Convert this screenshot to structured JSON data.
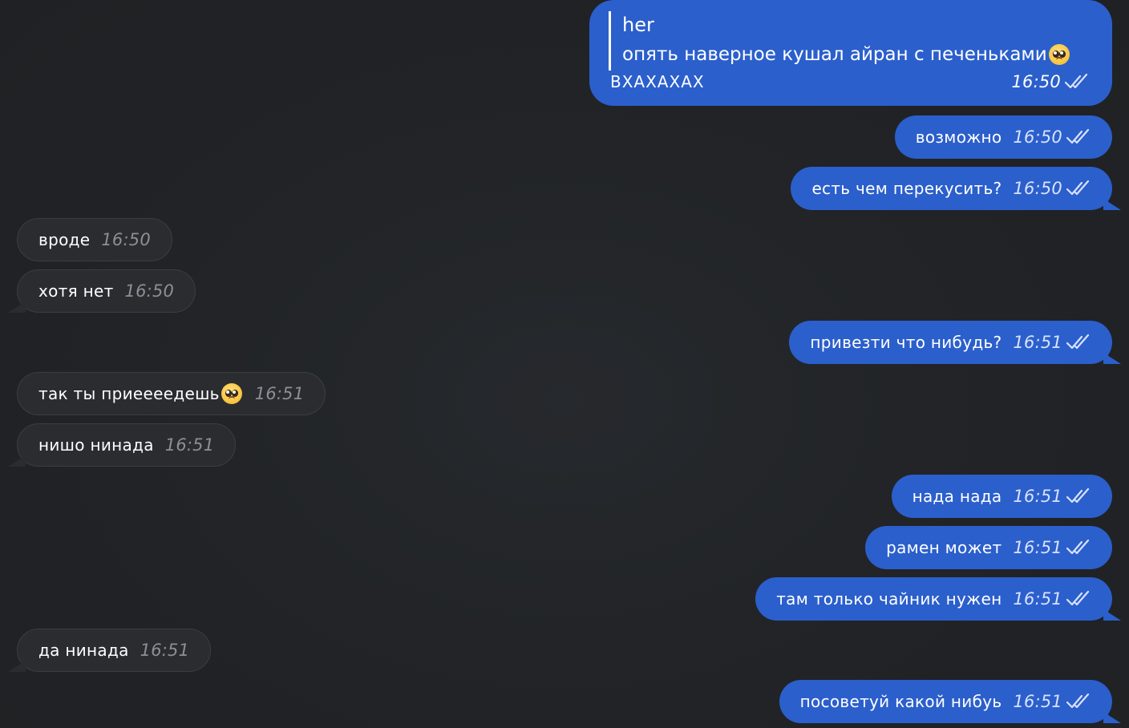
{
  "colors": {
    "background": "#212326",
    "outgoing_bubble": "#2b5fcc",
    "incoming_bubble": "#2a2c30",
    "incoming_time": "#8c8f96"
  },
  "reply_message": {
    "quote_author": "her",
    "quote_text": "опять наверное кушал айран с печеньками",
    "quote_emoji": "pleading-face-emoji",
    "text": "ВХАХАХАХ",
    "time": "16:50",
    "status_icon": "double-check-icon"
  },
  "messages": [
    {
      "direction": "out",
      "text": "возможно",
      "time": "16:50",
      "tail": false
    },
    {
      "direction": "out",
      "text": "есть чем перекусить?",
      "time": "16:50",
      "tail": true
    },
    {
      "direction": "in",
      "text": "вроде",
      "time": "16:50",
      "tail": false
    },
    {
      "direction": "in",
      "text": "хотя нет",
      "time": "16:50",
      "tail": true
    },
    {
      "direction": "out",
      "text": "привезти что нибудь?",
      "time": "16:51",
      "tail": true
    },
    {
      "direction": "in",
      "text": "так ты приеееедешь",
      "time": "16:51",
      "tail": false,
      "emoji": "pleading-face-emoji"
    },
    {
      "direction": "in",
      "text": "нишо нинада",
      "time": "16:51",
      "tail": true
    },
    {
      "direction": "out",
      "text": "нада нада",
      "time": "16:51",
      "tail": false
    },
    {
      "direction": "out",
      "text": "рамен может",
      "time": "16:51",
      "tail": false
    },
    {
      "direction": "out",
      "text": "там только чайник нужен",
      "time": "16:51",
      "tail": true
    },
    {
      "direction": "in",
      "text": "да нинада",
      "time": "16:51",
      "tail": true
    },
    {
      "direction": "out",
      "text": "посоветуй какой нибуь",
      "time": "16:51",
      "tail": true
    }
  ]
}
